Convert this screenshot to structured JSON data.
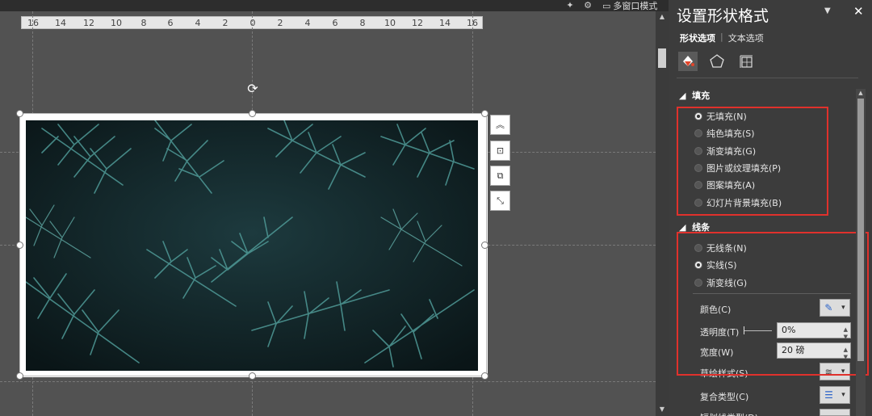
{
  "topbar": {
    "multi_window_label": "多窗口模式"
  },
  "ruler": {
    "ticks": [
      "16",
      "14",
      "12",
      "10",
      "8",
      "6",
      "4",
      "2",
      "0",
      "2",
      "4",
      "6",
      "8",
      "10",
      "12",
      "14",
      "16"
    ]
  },
  "panel": {
    "title": "设置形状格式",
    "tabs": {
      "shape_options": "形状选项",
      "text_options": "文本选项"
    },
    "fill": {
      "header": "填充",
      "options": [
        "无填充(N)",
        "纯色填充(S)",
        "渐变填充(G)",
        "图片或纹理填充(P)",
        "图案填充(A)",
        "幻灯片背景填充(B)"
      ],
      "selected": 0
    },
    "line": {
      "header": "线条",
      "options": [
        "无线条(N)",
        "实线(S)",
        "渐变线(G)"
      ],
      "selected": 1,
      "color_label": "颜色(C)",
      "transparency_label": "透明度(T)",
      "transparency_value": "0%",
      "width_label": "宽度(W)",
      "width_value": "20 磅",
      "sketch_label": "草绘样式(S)",
      "compound_label": "复合类型(C)",
      "dash_label": "短划线类型(D)"
    }
  },
  "colors": {
    "highlight_box": "#e0312c",
    "panel_bg": "#3c3c3c",
    "canvas_bg": "#525252"
  }
}
